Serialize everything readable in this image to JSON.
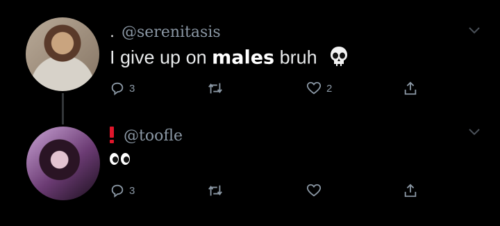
{
  "tweets": [
    {
      "handle": "@serenitasis",
      "prefix": ".",
      "text_before": "I give up on ",
      "text_bold": "males",
      "text_after": " bruh",
      "emoji": "skull-icon",
      "actions": {
        "replies": "3",
        "retweets": "",
        "likes": "2"
      }
    },
    {
      "handle": "@toofle",
      "prefix_icon": "exclamation-icon",
      "emoji": "eyes-icon",
      "actions": {
        "replies": "3",
        "retweets": "",
        "likes": ""
      }
    }
  ],
  "colors": {
    "background": "#000000",
    "text": "#e7e9ea",
    "muted": "#8b98a5",
    "alert": "#e0162b"
  }
}
